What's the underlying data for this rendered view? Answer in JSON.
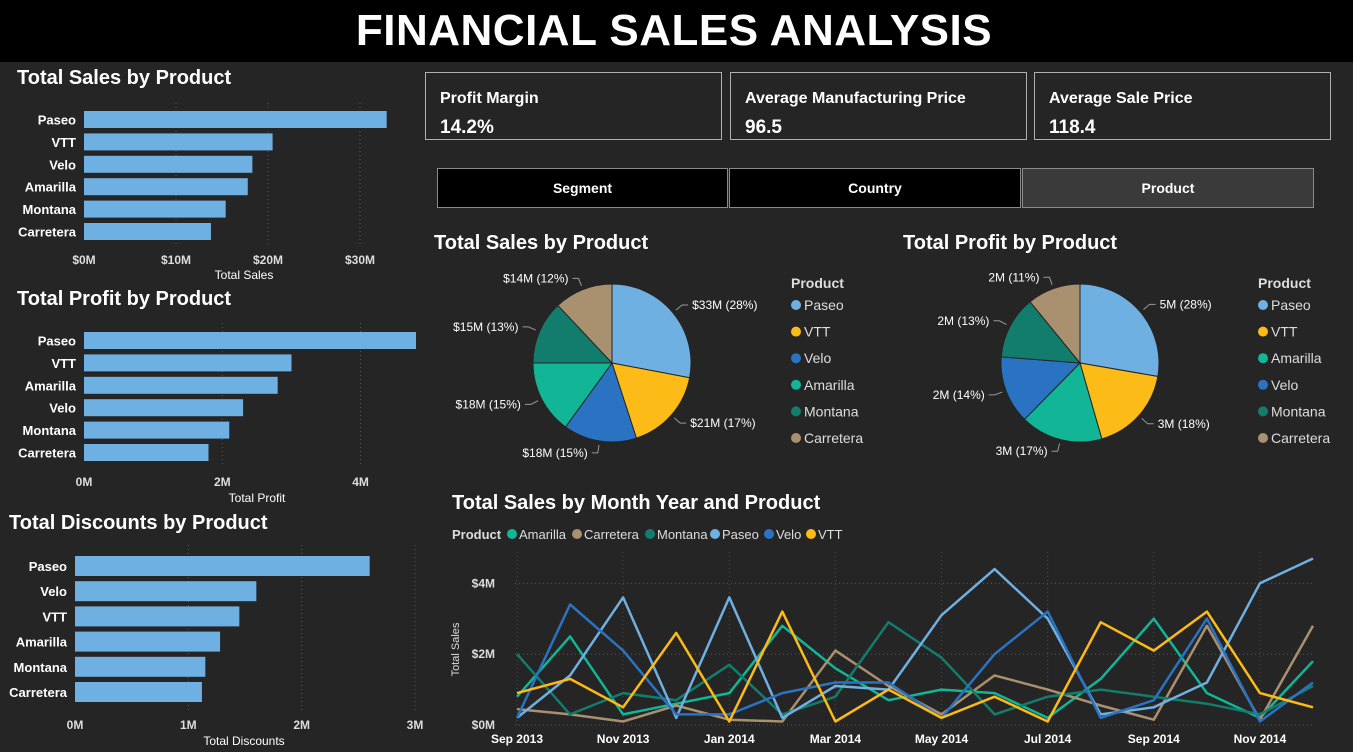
{
  "header": {
    "title": "FINANCIAL SALES ANALYSIS"
  },
  "colors": {
    "bar": "#6fb0e3",
    "Paseo": "#6fb0e3",
    "VTT": "#fdbb17",
    "Velo": "#2a73c2",
    "Amarilla": "#12b596",
    "Montana": "#127d6c",
    "Carretera": "#a9906e"
  },
  "kpis": [
    {
      "label": "Profit Margin",
      "value": "14.2%"
    },
    {
      "label": "Average Manufacturing Price",
      "value": "96.5"
    },
    {
      "label": "Average Sale Price",
      "value": "118.4"
    }
  ],
  "tabs": [
    {
      "label": "Segment",
      "selected": false
    },
    {
      "label": "Country",
      "selected": false
    },
    {
      "label": "Product",
      "selected": true
    }
  ],
  "charts": {
    "sales_bar": {
      "title": "Total Sales by Product",
      "type": "bar",
      "orientation": "horizontal",
      "categories": [
        "Paseo",
        "VTT",
        "Velo",
        "Amarilla",
        "Montana",
        "Carretera"
      ],
      "values": [
        32.9,
        20.5,
        18.3,
        17.8,
        15.4,
        13.8
      ],
      "xlabel": "Total Sales",
      "xticks": [
        "$0M",
        "$10M",
        "$20M",
        "$30M"
      ],
      "xlim": [
        0,
        40
      ]
    },
    "profit_bar": {
      "title": "Total Profit by Product",
      "type": "bar",
      "orientation": "horizontal",
      "categories": [
        "Paseo",
        "VTT",
        "Amarilla",
        "Velo",
        "Montana",
        "Carretera"
      ],
      "values": [
        4.8,
        3.0,
        2.8,
        2.3,
        2.1,
        1.8
      ],
      "xlabel": "Total Profit",
      "xticks": [
        "0M",
        "2M",
        "4M"
      ],
      "xlim": [
        0,
        4.8
      ]
    },
    "discount_bar": {
      "title": "Total Discounts by Product",
      "type": "bar",
      "orientation": "horizontal",
      "categories": [
        "Paseo",
        "Velo",
        "VTT",
        "Amarilla",
        "Montana",
        "Carretera"
      ],
      "values": [
        2.6,
        1.6,
        1.45,
        1.28,
        1.15,
        1.12
      ],
      "xlabel": "Total Discounts",
      "xticks": [
        "0M",
        "1M",
        "2M",
        "3M"
      ],
      "xlim": [
        0,
        3
      ]
    },
    "sales_pie": {
      "title": "Total Sales by Product",
      "type": "pie",
      "legend_title": "Product",
      "legend": [
        "Paseo",
        "VTT",
        "Velo",
        "Amarilla",
        "Montana",
        "Carretera"
      ],
      "slices": [
        {
          "name": "Paseo",
          "value": 28,
          "label": "$33M (28%)"
        },
        {
          "name": "VTT",
          "value": 17,
          "label": "$21M (17%)"
        },
        {
          "name": "Velo",
          "value": 15,
          "label": "$18M (15%)"
        },
        {
          "name": "Amarilla",
          "value": 15,
          "label": "$18M (15%)"
        },
        {
          "name": "Montana",
          "value": 13,
          "label": "$15M (13%)"
        },
        {
          "name": "Carretera",
          "value": 12,
          "label": "$14M (12%)"
        }
      ]
    },
    "profit_pie": {
      "title": "Total Profit by Product",
      "type": "pie",
      "legend_title": "Product",
      "legend": [
        "Paseo",
        "VTT",
        "Amarilla",
        "Velo",
        "Montana",
        "Carretera"
      ],
      "slices": [
        {
          "name": "Paseo",
          "value": 28,
          "label": "5M (28%)"
        },
        {
          "name": "VTT",
          "value": 18,
          "label": "3M (18%)"
        },
        {
          "name": "Amarilla",
          "value": 17,
          "label": "3M (17%)"
        },
        {
          "name": "Velo",
          "value": 14,
          "label": "2M (14%)"
        },
        {
          "name": "Montana",
          "value": 13,
          "label": "2M (13%)"
        },
        {
          "name": "Carretera",
          "value": 11,
          "label": "2M (11%)"
        }
      ]
    }
  },
  "chart_data": {
    "type": "line",
    "title": "Total Sales by Month Year and Product",
    "legend_title": "Product",
    "legend": [
      "Amarilla",
      "Carretera",
      "Montana",
      "Paseo",
      "Velo",
      "VTT"
    ],
    "ylabel": "Total Sales",
    "ylim": [
      0,
      4.6
    ],
    "yticks": [
      "$0M",
      "$2M",
      "$4M"
    ],
    "xticks": [
      "Sep 2013",
      "Nov 2013",
      "Jan 2014",
      "Mar 2014",
      "May 2014",
      "Jul 2014",
      "Sep 2014",
      "Nov 2014"
    ],
    "x": [
      "Sep 2013",
      "Oct 2013",
      "Nov 2013",
      "Dec 2013",
      "Jan 2014",
      "Feb 2014",
      "Mar 2014",
      "Apr 2014",
      "May 2014",
      "Jun 2014",
      "Jul 2014",
      "Aug 2014",
      "Sep 2014",
      "Oct 2014",
      "Nov 2014",
      "Dec 2014"
    ],
    "series": [
      {
        "name": "Amarilla",
        "values": [
          0.8,
          2.5,
          0.3,
          0.6,
          0.9,
          2.8,
          1.6,
          0.7,
          1.0,
          0.9,
          0.2,
          1.3,
          3.0,
          0.9,
          0.2,
          1.8
        ]
      },
      {
        "name": "Carretera",
        "values": [
          0.45,
          0.3,
          0.1,
          0.55,
          0.15,
          0.1,
          2.1,
          1.1,
          0.3,
          1.4,
          1.0,
          0.55,
          0.15,
          2.8,
          0.15,
          2.8
        ]
      },
      {
        "name": "Montana",
        "values": [
          2.0,
          0.3,
          0.9,
          0.7,
          1.7,
          0.3,
          0.8,
          2.9,
          1.9,
          0.3,
          0.8,
          1.0,
          0.8,
          0.6,
          0.3,
          1.1
        ]
      },
      {
        "name": "Paseo",
        "values": [
          0.2,
          1.4,
          3.6,
          0.2,
          3.6,
          0.2,
          1.1,
          1.0,
          3.1,
          4.4,
          3.0,
          0.3,
          0.5,
          1.2,
          4.0,
          4.7
        ]
      },
      {
        "name": "Velo",
        "values": [
          0.2,
          3.4,
          2.1,
          0.3,
          0.3,
          0.9,
          1.2,
          1.2,
          0.2,
          2.0,
          3.2,
          0.2,
          0.7,
          3.0,
          0.1,
          1.2
        ]
      },
      {
        "name": "VTT",
        "values": [
          0.9,
          1.3,
          0.5,
          2.6,
          0.1,
          3.2,
          0.1,
          1.0,
          0.2,
          0.8,
          0.1,
          2.9,
          2.1,
          3.2,
          0.9,
          0.5
        ]
      }
    ]
  }
}
